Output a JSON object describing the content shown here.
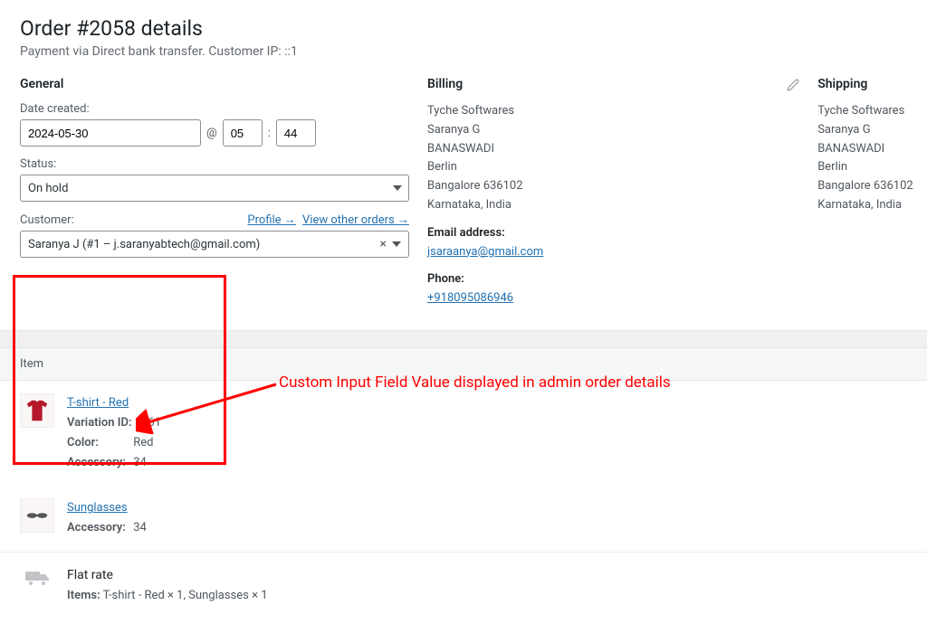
{
  "order": {
    "title": "Order #2058 details",
    "subtitle": "Payment via Direct bank transfer. Customer IP: ::1"
  },
  "general": {
    "heading": "General",
    "date_label": "Date created:",
    "date_value": "2024-05-30",
    "at_sep": "@",
    "hour": "05",
    "time_sep": ":",
    "minute": "44",
    "status_label": "Status:",
    "status_value": "On hold",
    "customer_label": "Customer:",
    "profile_link": "Profile →",
    "other_orders_link": "View other orders →",
    "customer_value": "Saranya J (#1 – j.saranyabtech@gmail.com)"
  },
  "billing": {
    "heading": "Billing",
    "lines": {
      "l1": "Tyche Softwares",
      "l2": "Saranya G",
      "l3": "BANASWADI",
      "l4": "Berlin",
      "l5": "Bangalore 636102",
      "l6": "Karnataka, India"
    },
    "email_label": "Email address:",
    "email": "jsaraanya@gmail.com",
    "phone_label": "Phone:",
    "phone": "+918095086946"
  },
  "shipping": {
    "heading": "Shipping",
    "lines": {
      "l1": "Tyche Softwares",
      "l2": "Saranya G",
      "l3": "BANASWADI",
      "l4": "Berlin",
      "l5": "Bangalore 636102",
      "l6": "Karnataka, India"
    }
  },
  "items": {
    "header": "Item",
    "rows": [
      {
        "name": "T-shirt - Red",
        "variation_label": "Variation ID:",
        "variation_id": "1061",
        "color_label": "Color:",
        "color": "Red",
        "accessory_label": "Accessory:",
        "accessory": "34"
      },
      {
        "name": "Sunglasses",
        "accessory_label": "Accessory:",
        "accessory": "34"
      }
    ]
  },
  "shipping_line": {
    "title": "Flat rate",
    "items_label": "Items:",
    "items_value": "T-shirt - Red × 1, Sunglasses × 1"
  },
  "annotation": {
    "text": "Custom Input Field Value displayed in admin order details"
  }
}
